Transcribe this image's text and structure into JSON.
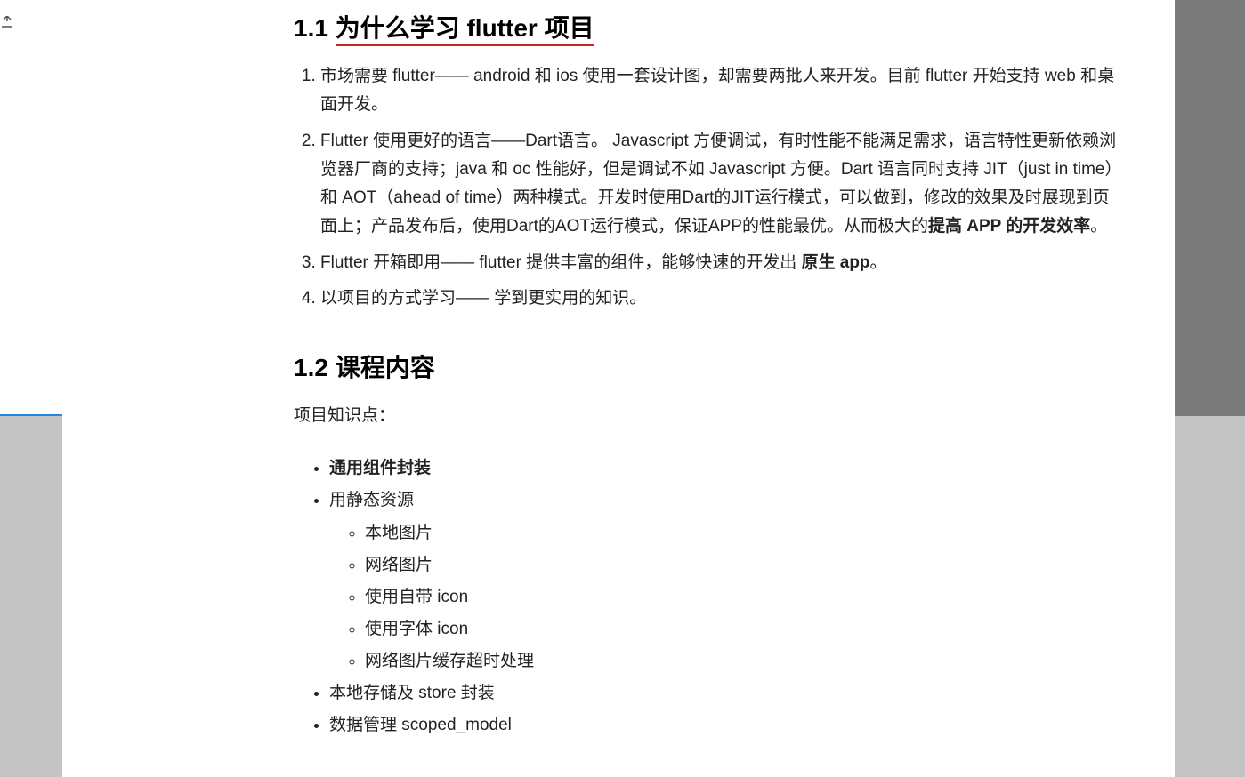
{
  "section1": {
    "number": "1.1 ",
    "title": "为什么学习 flutter 项目",
    "items": [
      {
        "pre": "市场需要 flutter—— android 和 ios 使用一套设计图，却需要两批人来开发。目前 flutter 开始支持 web 和桌面开发。"
      },
      {
        "pre": "Flutter 使用更好的语言——Dart语言。 Javascript 方便调试，有时性能不能满足需求，语言特性更新依赖浏览器厂商的支持；java 和 oc 性能好，但是调试不如 Javascript 方便。Dart 语言同时支持 JIT（just in time）和 AOT（ahead of time）两种模式。开发时使用Dart的JIT运行模式，可以做到，修改的效果及时展现到页面上；产品发布后，使用Dart的AOT运行模式，保证APP的性能最优。从而极大的",
        "bold": "提高 APP 的开发效率",
        "post": "。"
      },
      {
        "pre": "Flutter 开箱即用—— flutter 提供丰富的组件，能够快速的开发出 ",
        "bold": "原生 app",
        "post": "。"
      },
      {
        "pre": "以项目的方式学习—— 学到更实用的知识。"
      }
    ]
  },
  "section2": {
    "title": "1.2 课程内容",
    "intro": "项目知识点：",
    "bullets": [
      {
        "label": "通用组件封装",
        "bold": true
      },
      {
        "label": "用静态资源",
        "children": [
          "本地图片",
          "网络图片",
          "使用自带 icon",
          "使用字体 icon",
          "网络图片缓存超时处理"
        ]
      },
      {
        "label": "本地存储及 store 封装"
      },
      {
        "label": "数据管理 scoped_model"
      }
    ]
  },
  "colors": {
    "red": "#d32f2f",
    "blue": "#1976d2",
    "green": "#4caf50",
    "orange": "#d4a03a",
    "black": "#212121",
    "gray": "#757575",
    "white": "#ffffff",
    "magenta": "#e91e63"
  },
  "toolbar": {
    "rect": "rectangle",
    "circle": "circle",
    "line": "line",
    "arrow": "arrow",
    "pen": "pen",
    "mosaic": "mosaic",
    "text": "text",
    "number": "number",
    "crop": "crop",
    "undo": "undo",
    "close": "close",
    "pin": "pin",
    "download": "download",
    "copy": "copy"
  }
}
